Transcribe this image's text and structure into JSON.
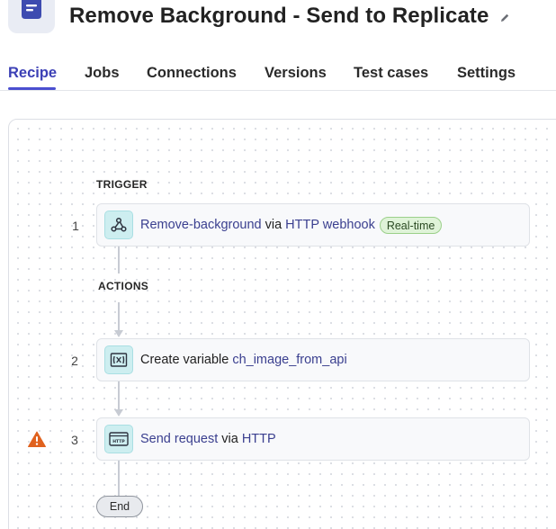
{
  "header": {
    "title": "Remove Background - Send to Replicate",
    "app_icon": "document-icon",
    "edit_icon": "pencil-icon"
  },
  "tabs": [
    {
      "label": "Recipe",
      "active": true
    },
    {
      "label": "Jobs",
      "active": false
    },
    {
      "label": "Connections",
      "active": false
    },
    {
      "label": "Versions",
      "active": false
    },
    {
      "label": "Test cases",
      "active": false
    },
    {
      "label": "Settings",
      "active": false
    }
  ],
  "recipe": {
    "trigger_label": "TRIGGER",
    "actions_label": "ACTIONS",
    "steps": [
      {
        "number": "1",
        "icon": "webhook-icon",
        "name": "Remove-background",
        "connector": "via",
        "app": "HTTP webhook",
        "badge": "Real-time"
      },
      {
        "number": "2",
        "icon": "variable-icon",
        "prefix": "Create variable",
        "name": "ch_image_from_api"
      },
      {
        "number": "3",
        "icon": "http-icon",
        "name": "Send request",
        "connector": "via",
        "app": "HTTP",
        "warning_icon": "warning-icon"
      }
    ],
    "end_label": "End"
  },
  "colors": {
    "accent": "#4b4fd0",
    "link": "#3a3f8f",
    "badge_bg": "#dff3d8",
    "warning": "#e0621f",
    "step_icon_bg": "#cdeef0"
  }
}
